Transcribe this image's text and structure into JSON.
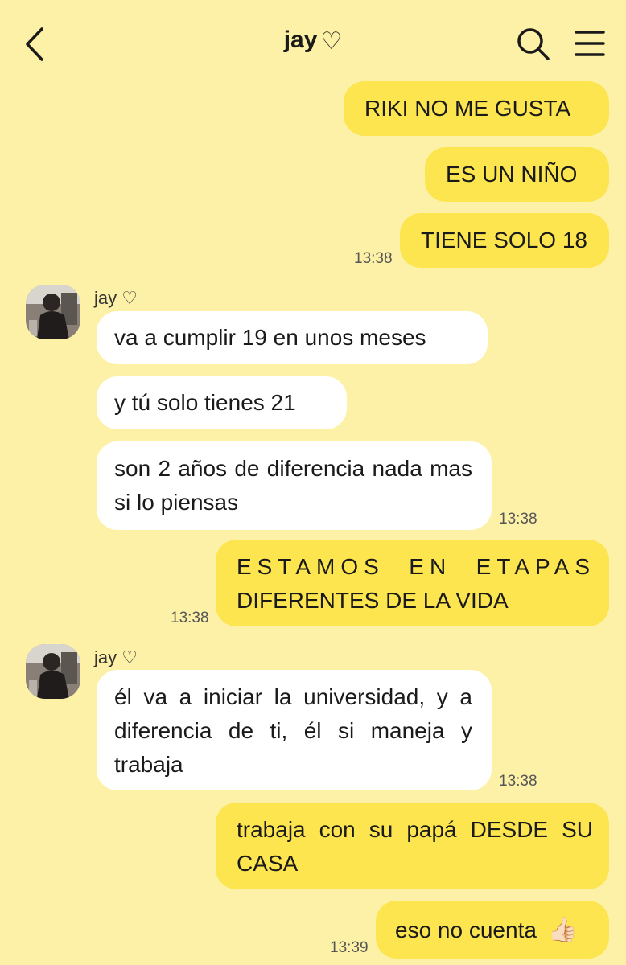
{
  "header": {
    "title": "jay",
    "heart": "♡"
  },
  "messages": {
    "m1": "RIKI NO ME GUSTA",
    "m2": "ES UN NIÑO",
    "m3": "TIENE SOLO 18",
    "t3": "13:38",
    "sender1": "jay ♡",
    "m4": "va a cumplir 19 en unos meses",
    "m5": "y tú solo tienes 21",
    "m6": "son 2 años de diferencia nada mas si lo piensas",
    "t6": "13:38",
    "m7a": "ESTAMOS EN ETAPAS",
    "m7b": "DIFERENTES DE LA VIDA",
    "t7": "13:38",
    "sender2": "jay ♡",
    "m8": "él va a iniciar la universidad, y a diferencia de ti, él si maneja y trabaja",
    "t8": "13:38",
    "m9": "trabaja con su papá DESDE SU CASA",
    "m10": "eso no cuenta",
    "m10_emoji": "👍🏻",
    "t10": "13:39"
  }
}
